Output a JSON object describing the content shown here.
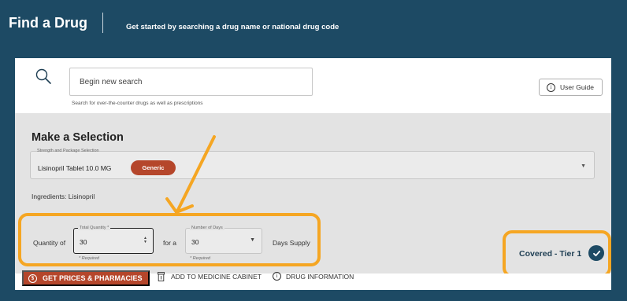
{
  "header": {
    "title": "Find a Drug",
    "subtitle": "Get started by searching a drug name or national drug code"
  },
  "search": {
    "placeholder": "Begin new search",
    "hint": "Search for over-the-counter drugs as well as prescriptions",
    "user_guide_label": "User Guide",
    "icon": "search-icon"
  },
  "selection": {
    "title": "Make a Selection",
    "strength_label": "Strength and Package Selection",
    "strength_value": "Lisinopril Tablet 10.0 MG",
    "badge": "Generic",
    "ingredients": "Ingredients: Lisinopril",
    "coverage": "Covered - Tier 1",
    "quantity_of": "Quantity of",
    "total_quantity_label": "Total Quantity *",
    "total_quantity_value": "30",
    "required_text": "* Required",
    "for_a": "for a",
    "days_label": "Number of Days",
    "days_value": "30",
    "days_supply": "Days Supply"
  },
  "actions": {
    "get_prices": "GET PRICES & PHARMACIES",
    "cabinet": "ADD TO MEDICINE CABINET",
    "drug_info": "DRUG INFORMATION"
  },
  "colors": {
    "header_bg": "#1d4a64",
    "accent": "#b5462b",
    "highlight": "#f5a623",
    "panel_gray": "#e3e3e3"
  }
}
